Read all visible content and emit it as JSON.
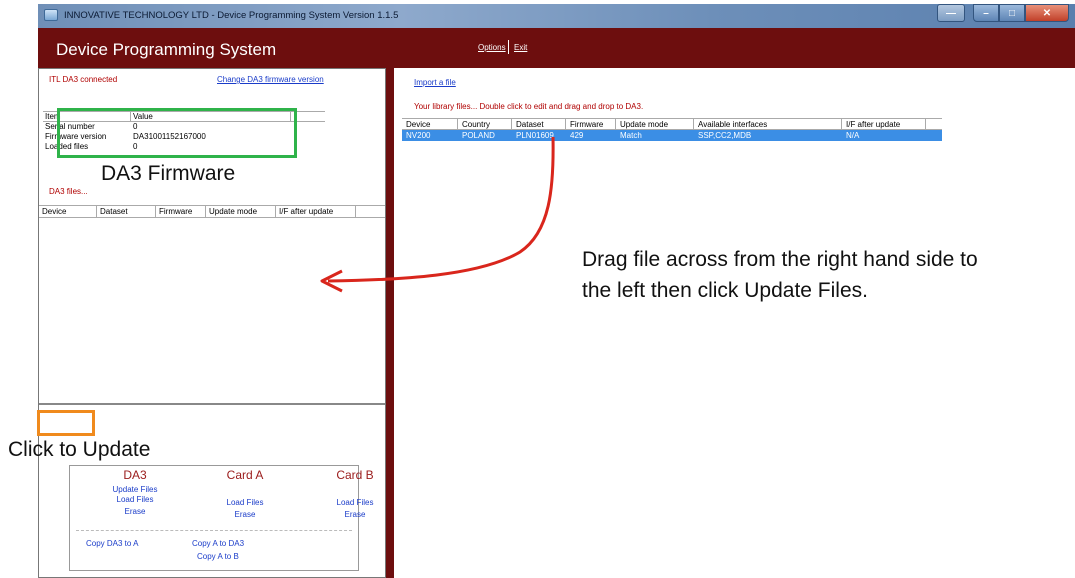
{
  "window": {
    "title": "INNOVATIVE TECHNOLOGY LTD  -  Device Programming System  Version 1.1.5",
    "icon": "app-icon",
    "controls": [
      "minimize-icon",
      "restore-icon",
      "close-icon"
    ]
  },
  "header": {
    "app_title": "Device Programming System",
    "options_label": "Options",
    "exit_label": "Exit"
  },
  "left": {
    "status": "ITL DA3 connected",
    "change_link": "Change DA3 firmware version",
    "info_table": {
      "headers": [
        "Item",
        "Value"
      ],
      "rows": [
        {
          "item": "Serial number",
          "value": "0"
        },
        {
          "item": "Firmware version",
          "value": "DA31001152167000"
        },
        {
          "item": "Loaded files",
          "value": "0"
        }
      ]
    },
    "da3_files_label": "DA3 files...",
    "files_table": {
      "headers": [
        "Device",
        "Dataset",
        "Firmware",
        "Update mode",
        "I/F after update"
      ]
    },
    "cards": {
      "da3": {
        "title": "DA3",
        "update": "Update Files",
        "load": "Load Files",
        "erase": "Erase"
      },
      "card_a": {
        "title": "Card A",
        "load": "Load Files",
        "erase": "Erase"
      },
      "card_b": {
        "title": "Card B",
        "load": "Load Files",
        "erase": "Erase"
      },
      "copy_da3_to_a": "Copy DA3 to A",
      "copy_a_to_da3": "Copy A to DA3",
      "copy_a_to_b": "Copy A to B"
    }
  },
  "right": {
    "import_link": "Import a file",
    "library_note": "Your library files...  Double click to edit and drag and drop to DA3.",
    "library_table": {
      "headers": [
        "Device",
        "Country",
        "Dataset",
        "Firmware",
        "Update mode",
        "Available interfaces",
        "I/F after update"
      ],
      "rows": [
        {
          "device": "NV200",
          "country": "POLAND",
          "dataset": "PLN01609",
          "firmware": "429",
          "update_mode": "Match",
          "interfaces": "SSP,CC2,MDB",
          "if_after": "N/A"
        }
      ]
    }
  },
  "annotations": {
    "firmware": "DA3 Firmware",
    "drag": "Drag file across from the right hand side to the left then click Update Files.",
    "click": "Click to Update"
  },
  "colors": {
    "header_red": "#6d0e0e",
    "highlight_green": "#2fb34a",
    "highlight_orange": "#f08a1d",
    "arrow_red": "#d9261c",
    "selection_blue": "#3b8ee5"
  }
}
